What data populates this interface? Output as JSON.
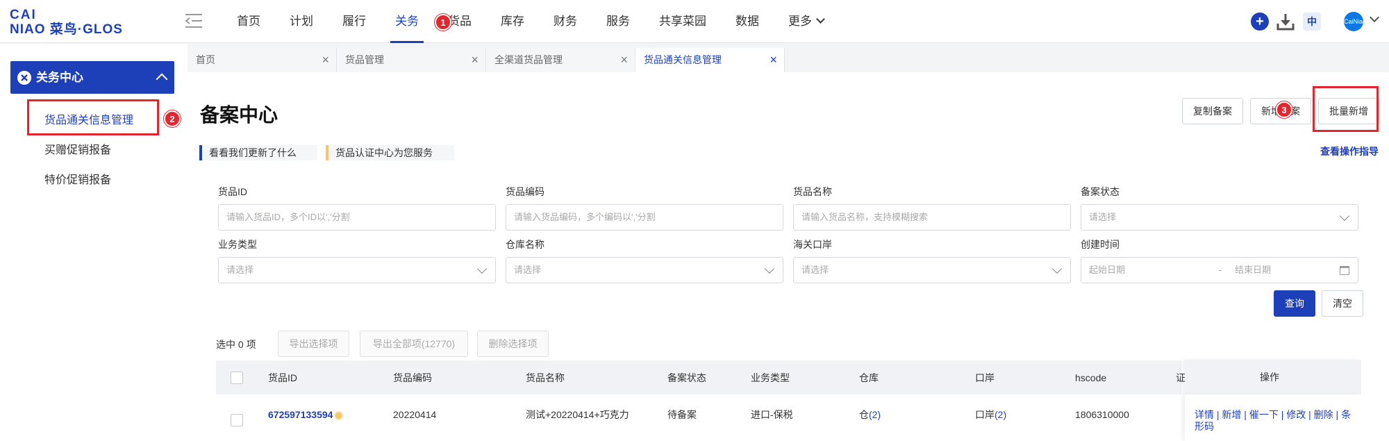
{
  "brand": {
    "logo_line1": "CAI",
    "logo_line2": "NIAO 菜鸟·GLOS"
  },
  "nav": {
    "items": [
      "首页",
      "计划",
      "履行",
      "关务",
      "货品",
      "库存",
      "财务",
      "服务",
      "共享菜园",
      "数据",
      "更多"
    ],
    "active_index": 3
  },
  "topbar_right": {
    "lang_label": "中",
    "avatar_text": "CaiNiao"
  },
  "annotations": [
    "1",
    "2",
    "3"
  ],
  "sidebar": {
    "group_title": "关务中心",
    "items": [
      "货品通关信息管理",
      "买赠促销报备",
      "特价促销报备"
    ]
  },
  "tabs": [
    "首页",
    "货品管理",
    "全渠道货品管理",
    "货品通关信息管理"
  ],
  "page": {
    "title": "备案中心",
    "actions": [
      "复制备案",
      "新增备案",
      "批量新增"
    ],
    "notices": [
      "看看我们更新了什么",
      "货品认证中心为您服务"
    ],
    "guide_link": "查看操作指导"
  },
  "filters": [
    {
      "label": "货品ID",
      "placeholder": "请输入货品ID，多个ID以','分割"
    },
    {
      "label": "货品编码",
      "placeholder": "请输入货品编码，多个编码以','分割"
    },
    {
      "label": "货品名称",
      "placeholder": "请输入货品名称，支持模糊搜索"
    },
    {
      "label": "备案状态",
      "placeholder": "请选择"
    },
    {
      "label": "业务类型",
      "placeholder": "请选择"
    },
    {
      "label": "仓库名称",
      "placeholder": "请选择"
    },
    {
      "label": "海关口岸",
      "placeholder": "请选择"
    },
    {
      "label": "创建时间",
      "start_placeholder": "起始日期",
      "separator": "-",
      "end_placeholder": "结束日期"
    }
  ],
  "filter_buttons": {
    "search": "查询",
    "clear": "清空"
  },
  "bulk": {
    "selected": "选中 0 项",
    "export_selected": "导出选择项",
    "export_all": "导出全部项(12770)",
    "delete_selected": "删除选择项"
  },
  "table": {
    "columns": [
      "货品ID",
      "货品编码",
      "货品名称",
      "备案状态",
      "业务类型",
      "仓库",
      "口岸",
      "hscode",
      "证",
      "操作"
    ],
    "rows": [
      {
        "id": "672597133594",
        "code": "20220414",
        "name": "测试+20220414+巧克力",
        "status": "待备案",
        "biz_type": "进口-保税",
        "warehouse_prefix": "仓",
        "warehouse_count": "(2)",
        "port_prefix": "口岸",
        "port_count": "(2)",
        "hscode": "1806310000",
        "ops": "详情 | 新增 | 催一下 | 修改 | 删除 | 条形码"
      }
    ]
  },
  "colors": {
    "brand_blue": "#1d3fb8",
    "annotation_red": "#e3262d",
    "notice_bar_1": "#1d3fb8",
    "notice_bar_2": "#f5c46b"
  }
}
